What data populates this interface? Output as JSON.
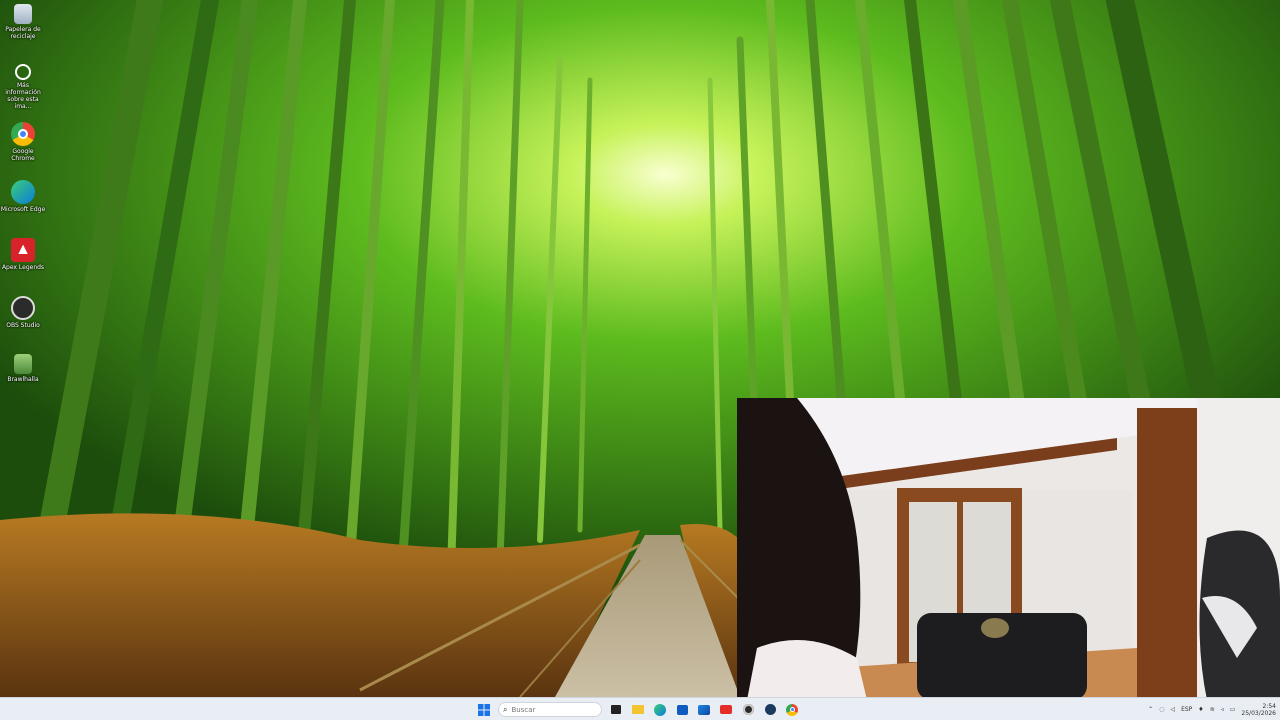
{
  "desktop": {
    "icons": [
      {
        "label": "Papelera de reciclaje",
        "icon": "recycle-bin-icon"
      },
      {
        "label": "Más información sobre esta ima...",
        "icon": "info-icon"
      },
      {
        "label": "Google Chrome",
        "icon": "chrome-icon"
      },
      {
        "label": "Microsoft Edge",
        "icon": "edge-icon"
      },
      {
        "label": "Apex Legends",
        "icon": "apex-legends-icon"
      },
      {
        "label": "OBS Studio",
        "icon": "obs-icon"
      },
      {
        "label": "Brawlhalla",
        "icon": "brawlhalla-icon"
      }
    ]
  },
  "taskbar": {
    "search_placeholder": "Buscar",
    "apps": [
      "start-icon",
      "search-icon",
      "task-view-icon",
      "file-explorer-icon",
      "edge-icon",
      "store-icon",
      "outlook-icon",
      "youtube-icon",
      "obs-icon",
      "steam-icon",
      "chrome-icon"
    ],
    "tray": {
      "language": "ESP",
      "time": "2:54",
      "date": "25/03/2026"
    }
  },
  "colors": {
    "taskbar_bg": "#e9eef5",
    "bamboo_light": "#9be03a",
    "bamboo_dark": "#1f5a10"
  }
}
